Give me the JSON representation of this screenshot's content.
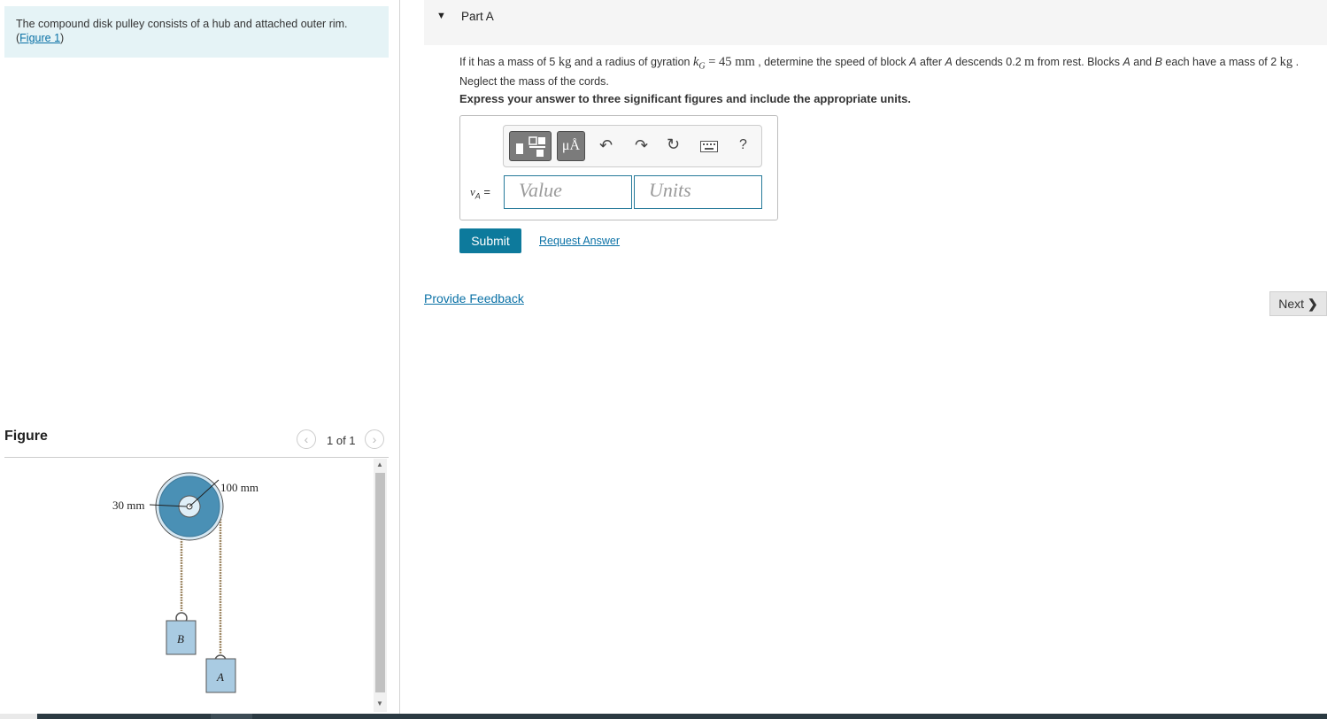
{
  "intro": {
    "text": "The compound disk pulley consists of a hub and attached outer rim.",
    "figure_link": "Figure 1",
    "paren_open": "(",
    "paren_close": ")"
  },
  "figure_panel": {
    "title": "Figure",
    "count": "1 of 1",
    "prev_icon": "chevron-left-icon",
    "next_icon": "chevron-right-icon",
    "labels": {
      "outer_radius": "100 mm",
      "hub_radius": "30 mm",
      "block_b": "B",
      "block_a": "A"
    },
    "colors": {
      "disk": "#4a90b5",
      "block": "#a9cbe2"
    }
  },
  "part": {
    "title": "Part A",
    "question": {
      "t1": "If it has a mass of 5 ",
      "u1": "kg",
      "t2": " and a radius of gyration ",
      "k": "k",
      "ksub": "G",
      "eq": " = 45 ",
      "u2": "mm",
      "t3": " , determine the speed of block ",
      "a1": "A",
      "t4": " after ",
      "a2": "A",
      "t5": " descends 0.2 ",
      "u3": "m",
      "t6": " from rest. Blocks ",
      "a3": "A",
      "t7": " and ",
      "b1": "B",
      "t8": " each have a mass of 2 ",
      "u4": "kg",
      "t9": " . Neglect the mass of the cords."
    },
    "instruction": "Express your answer to three significant figures and include the appropriate units."
  },
  "answer": {
    "variable": "v",
    "variable_sub": "A",
    "equals": " =",
    "value_placeholder": "Value",
    "units_placeholder": "Units",
    "toolbar": {
      "units_label": "μÅ",
      "help_label": "?",
      "icons": [
        "templates-icon",
        "units-icon",
        "undo-icon",
        "redo-icon",
        "reset-icon",
        "keyboard-icon",
        "help-icon"
      ]
    }
  },
  "actions": {
    "submit": "Submit",
    "request_answer": "Request Answer",
    "provide_feedback": "Provide Feedback",
    "next": "Next"
  }
}
